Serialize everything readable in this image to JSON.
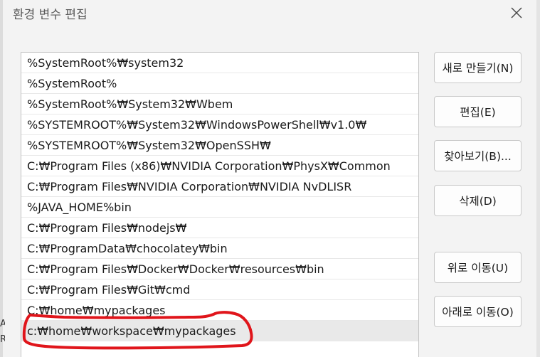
{
  "dialog": {
    "title": "환경 변수 편집",
    "close_icon": "close-icon"
  },
  "paths": [
    "%SystemRoot%₩system32",
    "%SystemRoot%",
    "%SystemRoot%₩System32₩Wbem",
    "%SYSTEMROOT%₩System32₩WindowsPowerShell₩v1.0₩",
    "%SYSTEMROOT%₩System32₩OpenSSH₩",
    "C:₩Program Files (x86)₩NVIDIA Corporation₩PhysX₩Common",
    "C:₩Program Files₩NVIDIA Corporation₩NVIDIA NvDLISR",
    "%JAVA_HOME%bin",
    "C:₩Program Files₩nodejs₩",
    "C:₩ProgramData₩chocolatey₩bin",
    "C:₩Program Files₩Docker₩Docker₩resources₩bin",
    "C:₩Program Files₩Git₩cmd",
    "C:₩home₩mypackages",
    "c:₩home₩workspace₩mypackages"
  ],
  "selected_index": 13,
  "buttons": {
    "new": "새로 만들기(N)",
    "edit": "편집(E)",
    "browse": "찾아보기(B)...",
    "delete": "삭제(D)",
    "move_up": "위로 이동(U)",
    "move_down": "아래로 이동(O)"
  },
  "left_edge_fragments": [
    "A",
    "R"
  ],
  "colors": {
    "dialog_bg": "#f3f3f3",
    "selected_row": "#e9e9e9",
    "annotation_red": "#e0151b"
  }
}
